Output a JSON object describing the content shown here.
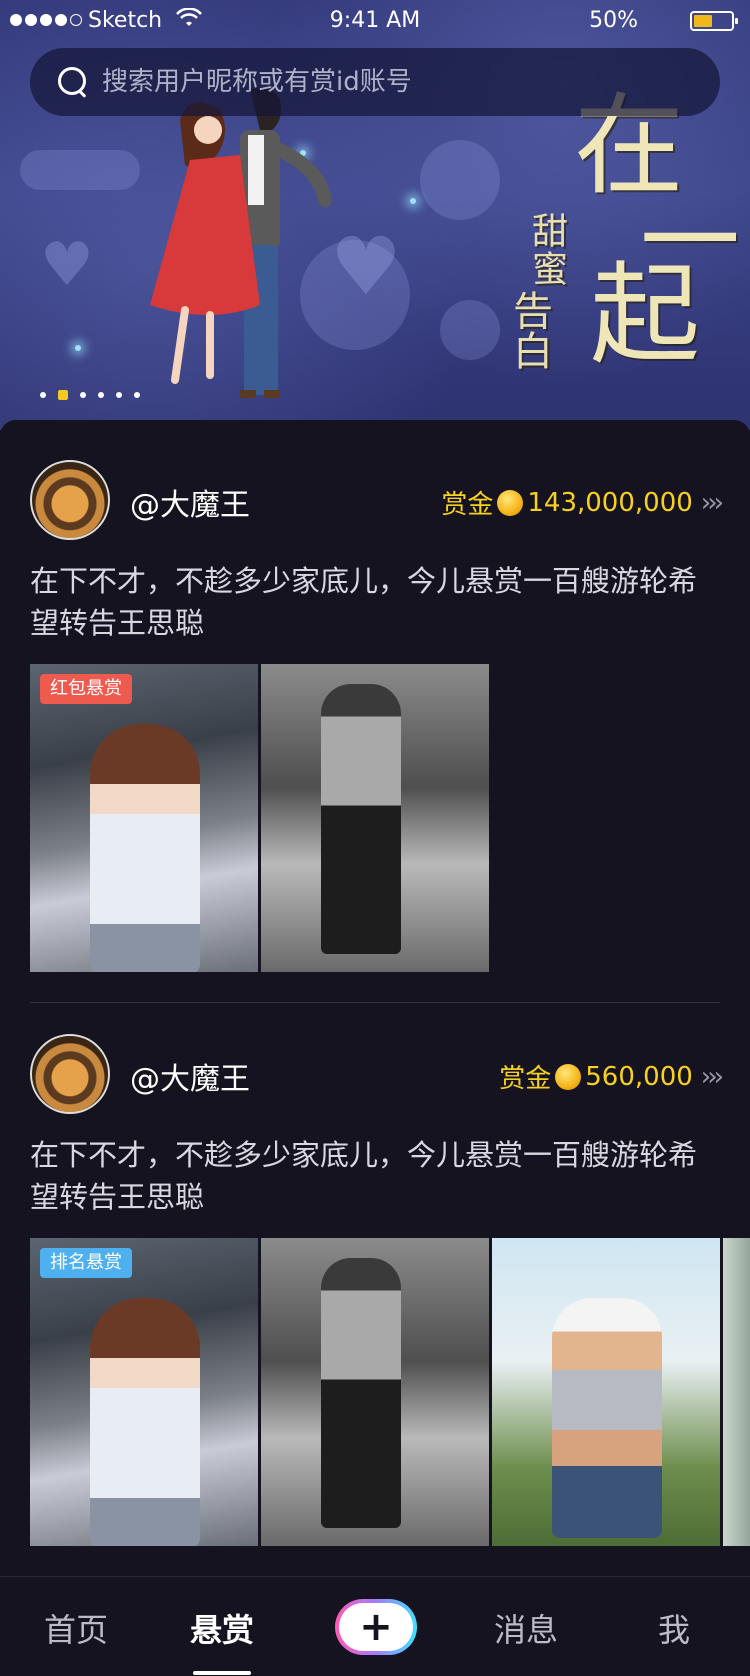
{
  "status_bar": {
    "carrier": "Sketch",
    "time": "9:41 AM",
    "battery_percent": "50%",
    "battery_level": 0.5
  },
  "search": {
    "placeholder": "搜索用户昵称或有赏id账号"
  },
  "banner": {
    "title_chars": [
      "在",
      "一",
      "起"
    ],
    "subtitle_1": "甜蜜",
    "subtitle_2": "告白",
    "page_count": 6,
    "active_page": 2
  },
  "posts": [
    {
      "username": "@大魔王",
      "reward_label": "赏金",
      "reward_amount": "143,000,000",
      "text": "在下不才，不趁多少家底儿，今儿悬赏一百艘游轮希望转告王思聪",
      "tag": "红包悬赏",
      "tag_color": "#ef5a4f",
      "image_count": 2
    },
    {
      "username": "@大魔王",
      "reward_label": "赏金",
      "reward_amount": "560,000",
      "text": "在下不才，不趁多少家底儿，今儿悬赏一百艘游轮希望转告王思聪",
      "tag": "排名悬赏",
      "tag_color": "#4fb0f0",
      "image_count": 4
    }
  ],
  "tab_bar": {
    "home": "首页",
    "reward": "悬赏",
    "plus": "+",
    "messages": "消息",
    "me": "我",
    "active": "reward"
  },
  "colors": {
    "background": "#15131f",
    "reward_text": "#f7d11e",
    "active_dot": "#f5c81f"
  }
}
